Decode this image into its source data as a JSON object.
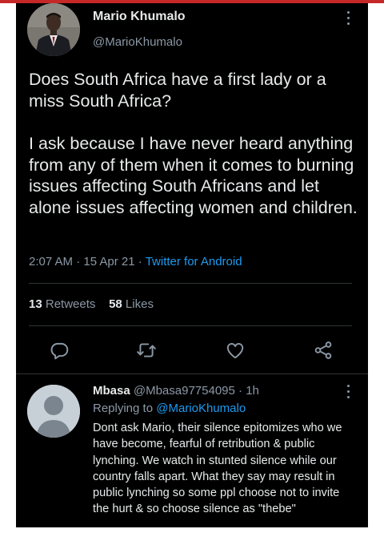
{
  "tweet": {
    "author_name": "Mario Khumalo",
    "author_handle": "@MarioKhumalo",
    "paragraphs": [
      "Does South Africa have a first lady or a miss South Africa?",
      "I ask because I have never heard anything from any of them when it comes to burning issues affecting South Africans and let alone issues affecting women and children."
    ],
    "time": "2:07 AM",
    "sep1": "·",
    "date": "15 Apr 21",
    "sep2": "·",
    "source": "Twitter for Android",
    "retweets_count": "13",
    "retweets_label": "Retweets",
    "likes_count": "58",
    "likes_label": "Likes"
  },
  "actions": [
    {
      "icon": "reply-icon"
    },
    {
      "icon": "retweet-icon"
    },
    {
      "icon": "like-icon"
    },
    {
      "icon": "share-icon"
    }
  ],
  "reply": {
    "author_name": "Mbasa",
    "author_handle": "@Mbasa97754095",
    "sep": "·",
    "time": "1h",
    "replying_prefix": "Replying to",
    "replying_to": "@MarioKhumalo",
    "text": "Dont ask Mario, their silence epitomizes who we have become, fearful of retribution & public lynching. We watch in stunted silence while our country falls apart. What they say may result in public lynching so some ppl choose not to invite the hurt & so choose silence as \"thebe\""
  },
  "colors": {
    "background": "#000000",
    "text": "#e7e9ea",
    "muted": "#8b98a5",
    "link": "#1d9bf0",
    "top_bar": "#c62828"
  }
}
